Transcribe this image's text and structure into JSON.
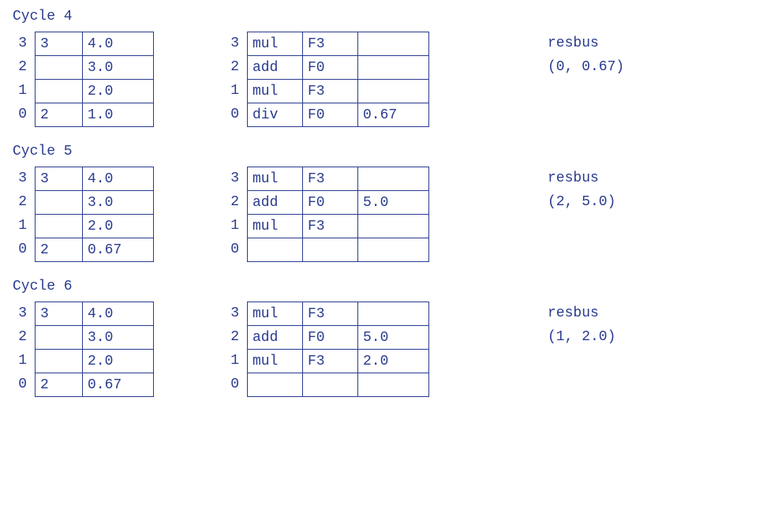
{
  "cycles": [
    {
      "title": "Cycle 4",
      "left_indices": [
        "3",
        "2",
        "1",
        "0"
      ],
      "left_rows": [
        [
          "3",
          "4.0"
        ],
        [
          "",
          "3.0"
        ],
        [
          "",
          "2.0"
        ],
        [
          "2",
          "1.0"
        ]
      ],
      "right_indices": [
        "3",
        "2",
        "1",
        "0"
      ],
      "right_rows": [
        [
          "mul",
          "F3",
          ""
        ],
        [
          "add",
          "F0",
          ""
        ],
        [
          "mul",
          "F3",
          ""
        ],
        [
          "div",
          "F0",
          "0.67"
        ]
      ],
      "resbus_label": "resbus",
      "resbus_value": "(0, 0.67)"
    },
    {
      "title": "Cycle 5",
      "left_indices": [
        "3",
        "2",
        "1",
        "0"
      ],
      "left_rows": [
        [
          "3",
          "4.0"
        ],
        [
          "",
          "3.0"
        ],
        [
          "",
          "2.0"
        ],
        [
          "2",
          "0.67"
        ]
      ],
      "right_indices": [
        "3",
        "2",
        "1",
        "0"
      ],
      "right_rows": [
        [
          "mul",
          "F3",
          ""
        ],
        [
          "add",
          "F0",
          "5.0"
        ],
        [
          "mul",
          "F3",
          ""
        ],
        [
          "",
          "",
          ""
        ]
      ],
      "resbus_label": "resbus",
      "resbus_value": "(2, 5.0)"
    },
    {
      "title": "Cycle 6",
      "left_indices": [
        "3",
        "2",
        "1",
        "0"
      ],
      "left_rows": [
        [
          "3",
          "4.0"
        ],
        [
          "",
          "3.0"
        ],
        [
          "",
          "2.0"
        ],
        [
          "2",
          "0.67"
        ]
      ],
      "right_indices": [
        "3",
        "2",
        "1",
        "0"
      ],
      "right_rows": [
        [
          "mul",
          "F3",
          ""
        ],
        [
          "add",
          "F0",
          "5.0"
        ],
        [
          "mul",
          "F3",
          "2.0"
        ],
        [
          "",
          "",
          ""
        ]
      ],
      "resbus_label": "resbus",
      "resbus_value": "(1, 2.0)"
    }
  ]
}
